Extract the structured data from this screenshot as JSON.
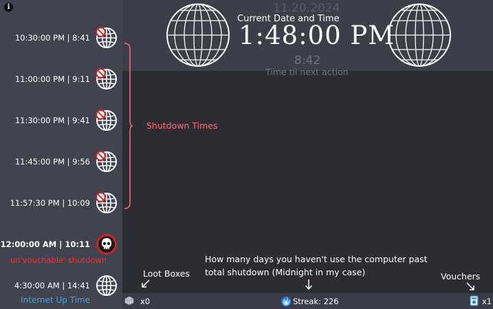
{
  "header": {
    "date": "11.20.2024",
    "subtitle": "Current Date and Time",
    "clock": "1:48:00 PM",
    "countdown": "8:42",
    "countdown_label": "Time til next action"
  },
  "sidebar": {
    "rows": [
      {
        "text": "10:30:00 PM | 8:41",
        "icon": "globe-blocked-icon"
      },
      {
        "text": "11:00:00 PM | 9:11",
        "icon": "globe-blocked-icon"
      },
      {
        "text": "11:30:00 PM | 9:41",
        "icon": "globe-blocked-icon"
      },
      {
        "text": "11:45:00 PM | 9:56",
        "icon": "globe-blocked-icon"
      },
      {
        "text": "11:57:30 PM | 10:09",
        "icon": "globe-blocked-icon"
      },
      {
        "text": "12:00:00 AM | 10:11",
        "icon": "skull-icon",
        "note": "un'vouchable' shutdown"
      },
      {
        "text": "4:30:00 AM | 14:41",
        "icon": "globe-icon",
        "note": "Internet Up Time"
      }
    ]
  },
  "annotations": {
    "shutdown_times": "Shutdown Times",
    "loot_boxes": "Loot Boxes",
    "streak_desc_line1": "How many days you haven't use the computer past",
    "streak_desc_line2": "total shutdown (Midnight in my case)",
    "vouchers": "Vouchers"
  },
  "status_bar": {
    "loot_count": "x0",
    "streak": "Streak: 226",
    "voucher_count": "x1"
  },
  "colors": {
    "sidebar_bg": "#41444f",
    "main_bg": "#2b2d33",
    "annotation_pink": "#ff6b7a",
    "shutdown_red": "#ff2a2a",
    "uptime_blue": "#39a6e6"
  }
}
